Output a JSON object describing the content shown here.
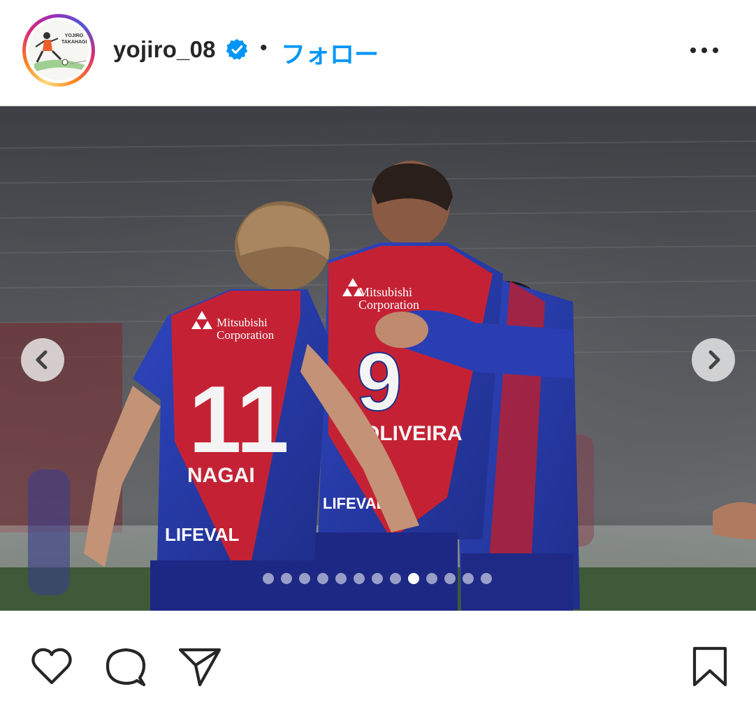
{
  "post": {
    "username": "yojiro_08",
    "verified": true,
    "separator": "•",
    "follow_label": "フォロー",
    "avatar_caption": "YOJIRO TAKAHAGI"
  },
  "photo": {
    "jerseys": [
      {
        "number": "11",
        "name": "NAGAI",
        "sponsor": "Mitsubishi Corporation",
        "sleeve": "LIFEVAL"
      },
      {
        "number": "9",
        "name": "OLIVEIRA",
        "sponsor": "Mitsubishi Corporation",
        "sleeve": "LIFEVAL"
      }
    ]
  },
  "carousel": {
    "total": 13,
    "active_index": 8
  },
  "icons": {
    "more": "more-options-icon",
    "verified": "verified-badge-icon",
    "prev": "chevron-left-icon",
    "next": "chevron-right-icon",
    "like": "heart-icon",
    "comment": "comment-bubble-icon",
    "share": "paper-plane-icon",
    "save": "bookmark-icon"
  },
  "colors": {
    "follow": "#0095f6",
    "verified": "#0095f6",
    "fc_blue": "#2438a8",
    "fc_red": "#c42234"
  }
}
